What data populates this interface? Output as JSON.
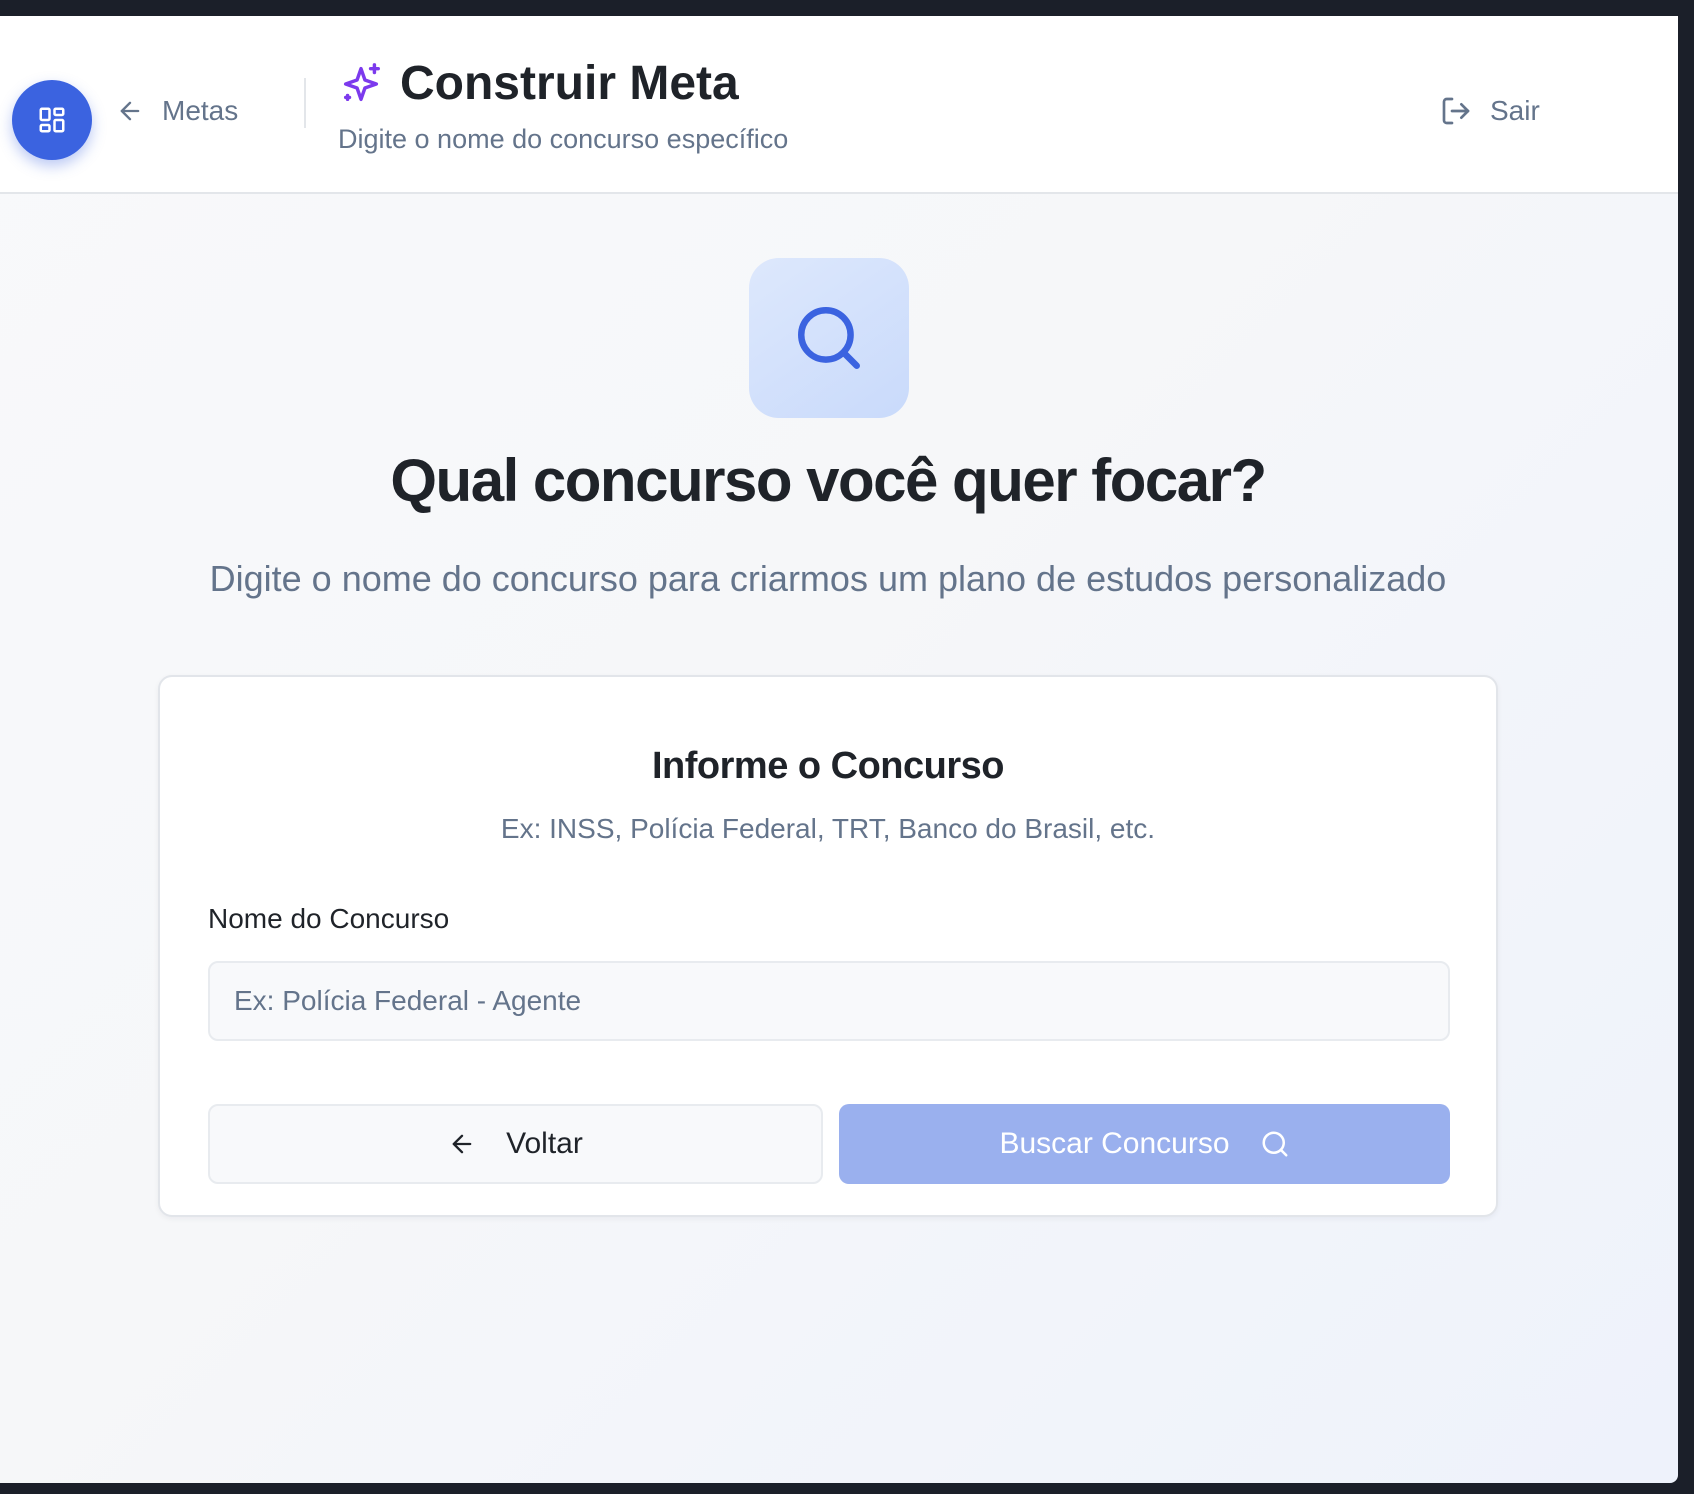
{
  "header": {
    "back_label": "Metas",
    "title": "Construir Meta",
    "subtitle": "Digite o nome do concurso específico",
    "logout_label": "Sair"
  },
  "hero": {
    "title": "Qual concurso você quer focar?",
    "subtitle": "Digite o nome do concurso para criarmos um plano de estudos personalizado"
  },
  "card": {
    "title": "Informe o Concurso",
    "subtitle": "Ex: INSS, Polícia Federal, TRT, Banco do Brasil, etc.",
    "field_label": "Nome do Concurso",
    "input_value": "",
    "input_placeholder": "Ex: Polícia Federal - Agente",
    "back_button": "Voltar",
    "search_button": "Buscar Concurso"
  },
  "icons": {
    "fab": "dashboard-grid-icon",
    "back": "arrow-left-icon",
    "title": "sparkles-icon",
    "logout": "log-out-icon",
    "hero": "search-icon",
    "search_button": "search-icon"
  },
  "colors": {
    "accent": "#3b63e0",
    "sparkle": "#7c3aed",
    "search_button_disabled": "#9ab0ee",
    "hero_icon_bg": "#d3e1fb",
    "text_primary": "#1f2329",
    "text_muted": "#64748b"
  }
}
